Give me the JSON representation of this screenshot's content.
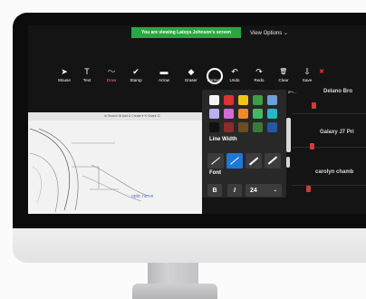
{
  "topbar": {
    "banner_text": "You are viewing Latoya Johnson's screen",
    "view_options_label": "View Options ⌄"
  },
  "toolbar": {
    "items": [
      {
        "label": "Mouse",
        "icon": "cursor-icon",
        "glyph": "➤"
      },
      {
        "label": "Text",
        "icon": "text-icon",
        "glyph": "T"
      },
      {
        "label": "Draw",
        "icon": "draw-icon",
        "glyph": "〜",
        "active": true
      },
      {
        "label": "Stamp",
        "icon": "stamp-icon",
        "glyph": "✔"
      },
      {
        "label": "Arrow",
        "icon": "arrow-icon",
        "glyph": "▬"
      },
      {
        "label": "Eraser",
        "icon": "eraser-icon",
        "glyph": "◆"
      },
      {
        "label": "Format",
        "icon": "format-icon",
        "glyph": "○"
      },
      {
        "label": "Undo",
        "icon": "undo-icon",
        "glyph": "↶"
      },
      {
        "label": "Redo",
        "icon": "redo-icon",
        "glyph": "↷"
      },
      {
        "label": "Clear",
        "icon": "trash-icon",
        "glyph": "🗑"
      },
      {
        "label": "Save",
        "icon": "save-icon",
        "glyph": "⇩"
      }
    ],
    "close_glyph": "✖"
  },
  "format_panel": {
    "colors": [
      "#f4f4f4",
      "#e03131",
      "#f0c419",
      "#3f9c3f",
      "#6fa0d8",
      "#b8b1f0",
      "#d36bd6",
      "#f08a24",
      "#47b862",
      "#26b7c9",
      "#111111",
      "#8e2b2b",
      "#6b4d1e",
      "#3a7a3a",
      "#2458a6"
    ],
    "line_width_label": "Line Width",
    "font_label": "Font",
    "bold_label": "B",
    "italic_label": "I",
    "font_size": "24",
    "font_size_arrow": "⌄"
  },
  "gallery": {
    "names": [
      "Delano Bro",
      "Galaxy J7 Pri",
      "carolyn chamb"
    ],
    "small_label": "IP+..."
  },
  "whiteboard": {
    "toolbar_text": "⊕ Search   ⊞ Add & Create ▾   ⟲ Share   ⊡",
    "annotation": "optic nerve"
  }
}
